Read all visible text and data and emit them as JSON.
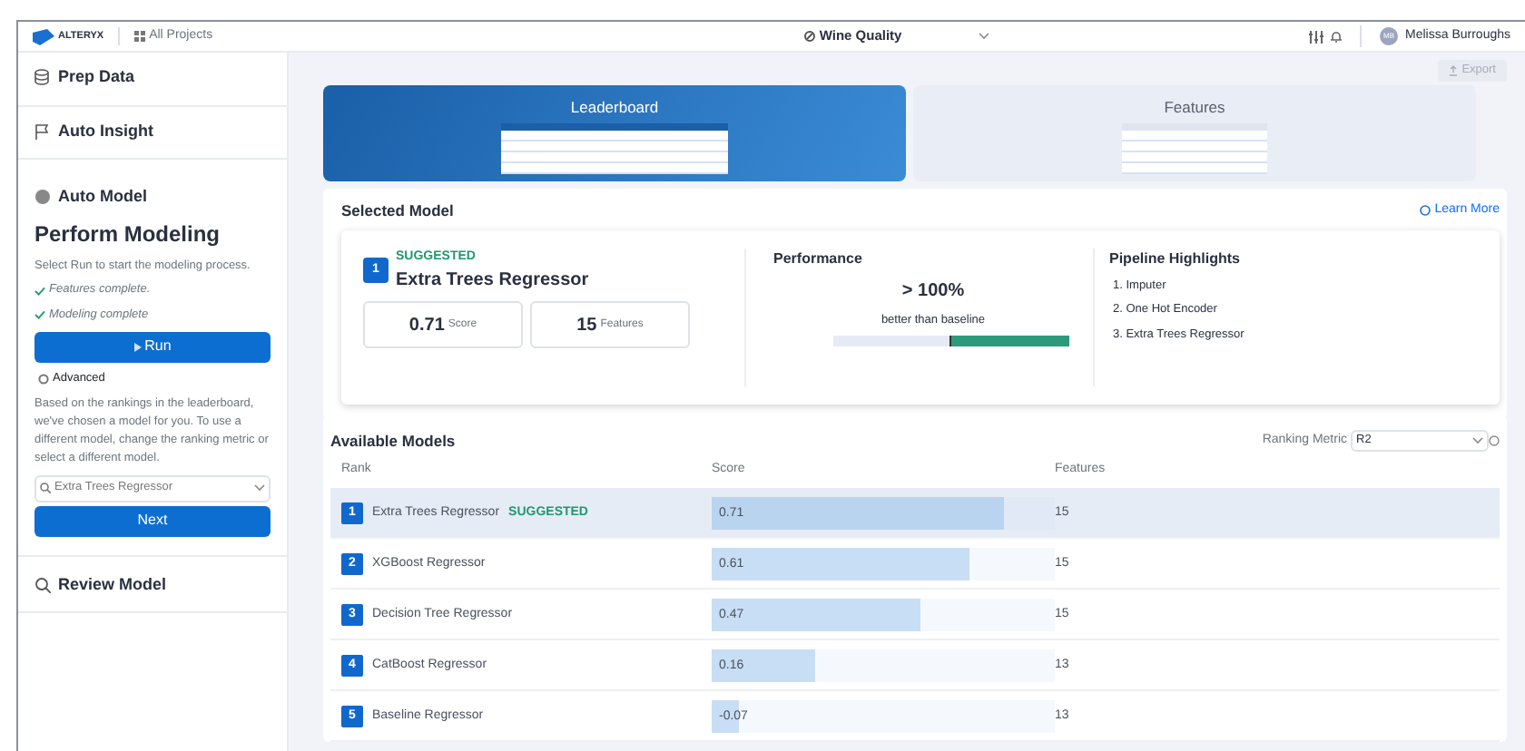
{
  "header": {
    "brand": "ALTERYX",
    "projects_link": "All Projects",
    "project_title": "Wine Quality",
    "user_name": "Melissa Burroughs",
    "user_initials": "MB"
  },
  "sidebar": {
    "sections": [
      {
        "kind": "step",
        "title": "Prep Data"
      },
      {
        "kind": "step",
        "title": "Auto Insight"
      },
      {
        "kind": "active",
        "title": "Auto Model",
        "heading": "Perform Modeling",
        "instruction": "Select Run to start the modeling process.",
        "statuses": [
          "Features complete.",
          "Modeling complete"
        ],
        "run_button": "Run",
        "advanced": "Advanced",
        "description": "Based on the rankings in the leaderboard, we've chosen a model for you. To use a different model, change the ranking metric or select a different model.",
        "model_select": "Extra Trees Regressor",
        "next_button": "Next"
      },
      {
        "kind": "step",
        "title": "Review Model"
      }
    ]
  },
  "export_button": "Export",
  "view_tabs": [
    {
      "label": "Leaderboard",
      "selected": true
    },
    {
      "label": "Features",
      "selected": false
    }
  ],
  "selected_model": {
    "title": "Selected Model",
    "learn_more": "Learn More",
    "rank": "1",
    "tag": "SUGGESTED",
    "name": "Extra Trees Regressor",
    "score": "0.71",
    "score_label": "Score",
    "features": "15",
    "features_label": "Features",
    "performance_title": "Performance",
    "performance_value": "> 100%",
    "performance_caption": "better than baseline",
    "pipeline_title": "Pipeline Highlights",
    "pipeline": [
      "1. Imputer",
      "2. One Hot Encoder",
      "3. Extra Trees Regressor"
    ]
  },
  "available_models": {
    "title": "Available Models",
    "metric_label": "Ranking Metric",
    "metric_value": "R2",
    "columns": [
      "Rank",
      "Score",
      "Features"
    ],
    "rows": [
      {
        "rank": "1",
        "name": "Extra Trees Regressor",
        "tag": "SUGGESTED",
        "score": "0.71",
        "level": 0.85,
        "features": "15",
        "selected": true
      },
      {
        "rank": "2",
        "name": "XGBoost Regressor",
        "score": "0.61",
        "level": 0.75,
        "features": "15",
        "selected": false
      },
      {
        "rank": "3",
        "name": "Decision Tree Regressor",
        "score": "0.47",
        "level": 0.61,
        "features": "15",
        "selected": false
      },
      {
        "rank": "4",
        "name": "CatBoost Regressor",
        "score": "0.16",
        "level": 0.3,
        "features": "13",
        "selected": false
      },
      {
        "rank": "5",
        "name": "Baseline Regressor",
        "score": "-0.07",
        "level": 0.08,
        "features": "13",
        "selected": false
      }
    ]
  }
}
